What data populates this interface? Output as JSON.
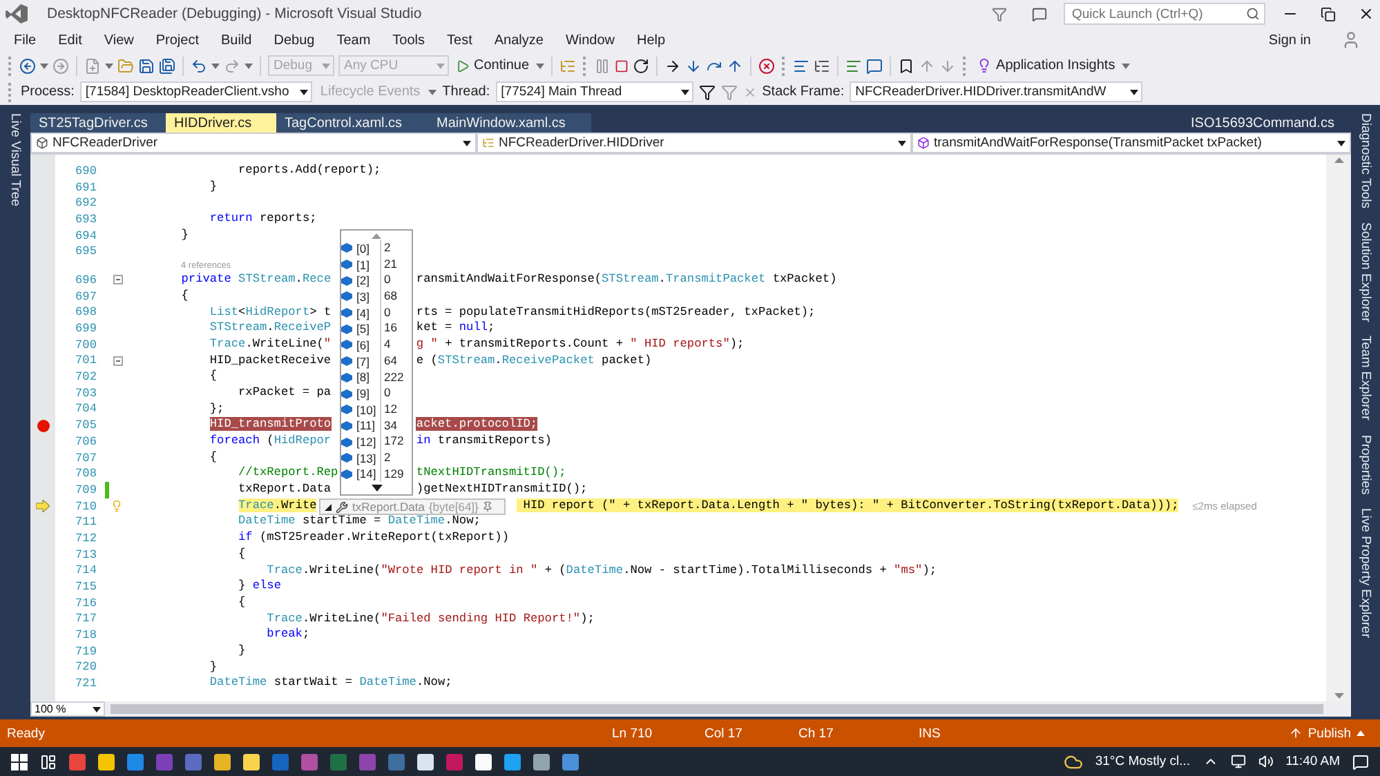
{
  "window": {
    "title": "DesktopNFCReader (Debugging) - Microsoft Visual Studio"
  },
  "quick_launch": {
    "placeholder": "Quick Launch (Ctrl+Q)"
  },
  "menu": [
    "File",
    "Edit",
    "View",
    "Project",
    "Build",
    "Debug",
    "Team",
    "Tools",
    "Test",
    "Analyze",
    "Window",
    "Help"
  ],
  "account": {
    "label": "Sign in"
  },
  "toolbar": {
    "configuration": {
      "value": "Debug",
      "disabled": true
    },
    "platform": {
      "value": "Any CPU",
      "disabled": true
    },
    "continue": "Continue",
    "insights": "Application Insights"
  },
  "debug_location": {
    "process_label": "Process:",
    "process": "[71584] DesktopReaderClient.vsho",
    "lifecycle": {
      "label": "Lifecycle Events",
      "disabled": true
    },
    "thread_label": "Thread:",
    "thread": "[77524] Main Thread",
    "stack_label": "Stack Frame:",
    "stack_frame": "NFCReaderDriver.HIDDriver.transmitAndW"
  },
  "left_panels": [
    "Live Visual Tree"
  ],
  "right_panels": [
    "Diagnostic Tools",
    "Solution Explorer",
    "Team Explorer",
    "Properties",
    "Live Property Explorer"
  ],
  "tabs": [
    {
      "label": "ST25TagDriver.cs",
      "selected": false
    },
    {
      "label": "HIDDriver.cs",
      "selected": true
    },
    {
      "label": "TagControl.xaml.cs",
      "selected": false
    },
    {
      "label": "MainWindow.xaml.cs",
      "selected": false
    }
  ],
  "preview_tab": {
    "label": "ISO15693Command.cs",
    "selected": false
  },
  "navigation": {
    "project": "NFCReaderDriver",
    "type": "NFCReaderDriver.HIDDriver",
    "member": "transmitAndWaitForResponse(TransmitPacket txPacket)"
  },
  "code": {
    "lines": [
      {
        "number": "690",
        "breakpoint": false,
        "current": false,
        "changed": false,
        "fold": false,
        "tokens": [
          {
            "kind": "plain",
            "text": "                reports.Add(report);"
          }
        ]
      },
      {
        "number": "691",
        "breakpoint": false,
        "current": false,
        "changed": false,
        "fold": false,
        "tokens": [
          {
            "kind": "plain",
            "text": "            }"
          }
        ]
      },
      {
        "number": "692",
        "breakpoint": false,
        "current": false,
        "changed": false,
        "fold": false
      },
      {
        "number": "693",
        "breakpoint": false,
        "current": false,
        "changed": false,
        "fold": false,
        "tokens": [
          {
            "kind": "keyword",
            "text": "            return"
          },
          {
            "kind": "plain",
            "text": " reports;"
          }
        ]
      },
      {
        "number": "694",
        "breakpoint": false,
        "current": false,
        "changed": false,
        "fold": false,
        "tokens": [
          {
            "kind": "plain",
            "text": "        }"
          }
        ]
      },
      {
        "number": "695",
        "breakpoint": false,
        "current": false,
        "changed": false,
        "fold": false
      },
      {
        "number": "696",
        "breakpoint": false,
        "current": false,
        "changed": false,
        "fold": true,
        "references": "4 references",
        "tokens": [
          {
            "kind": "keyword",
            "text": "        private "
          },
          {
            "kind": "type",
            "text": "STStream"
          },
          {
            "kind": "plain",
            "text": "."
          },
          {
            "kind": "type",
            "text": "Rece"
          }
        ],
        "after": [
          {
            "kind": "plain",
            "text": "ransmitAndWaitForResponse("
          },
          {
            "kind": "type",
            "text": "STStream"
          },
          {
            "kind": "plain",
            "text": "."
          },
          {
            "kind": "type",
            "text": "TransmitPacket"
          },
          {
            "kind": "plain",
            "text": " txPacket)"
          }
        ]
      },
      {
        "number": "697",
        "breakpoint": false,
        "current": false,
        "changed": false,
        "fold": false,
        "tokens": [
          {
            "kind": "plain",
            "text": "        {"
          }
        ]
      },
      {
        "number": "698",
        "breakpoint": false,
        "current": false,
        "changed": false,
        "fold": false,
        "tokens": [
          {
            "kind": "type",
            "text": "            List"
          },
          {
            "kind": "plain",
            "text": "<"
          },
          {
            "kind": "type",
            "text": "HidReport"
          },
          {
            "kind": "plain",
            "text": "> t"
          }
        ],
        "after": [
          {
            "kind": "plain",
            "text": "rts = populateTransmitHidReports(mST25reader, txPacket);"
          }
        ]
      },
      {
        "number": "699",
        "breakpoint": false,
        "current": false,
        "changed": false,
        "fold": false,
        "tokens": [
          {
            "kind": "type",
            "text": "            STStream"
          },
          {
            "kind": "plain",
            "text": "."
          },
          {
            "kind": "type",
            "text": "ReceiveP"
          }
        ],
        "after": [
          {
            "kind": "plain",
            "text": "ket = "
          },
          {
            "kind": "keyword",
            "text": "null"
          },
          {
            "kind": "plain",
            "text": ";"
          }
        ]
      },
      {
        "number": "700",
        "breakpoint": false,
        "current": false,
        "changed": false,
        "fold": false,
        "tokens": [
          {
            "kind": "type",
            "text": "            Trace"
          },
          {
            "kind": "plain",
            "text": ".WriteLine("
          },
          {
            "kind": "string",
            "text": "\""
          }
        ],
        "after": [
          {
            "kind": "string",
            "text": "g \""
          },
          {
            "kind": "plain",
            "text": " + transmitReports.Count + "
          },
          {
            "kind": "string",
            "text": "\" HID reports\""
          },
          {
            "kind": "plain",
            "text": ");"
          }
        ]
      },
      {
        "number": "701",
        "breakpoint": false,
        "current": false,
        "changed": false,
        "fold": true,
        "tokens": [
          {
            "kind": "plain",
            "text": "            HID_packetReceive"
          }
        ],
        "after": [
          {
            "kind": "plain",
            "text": "e ("
          },
          {
            "kind": "type",
            "text": "STStream"
          },
          {
            "kind": "plain",
            "text": "."
          },
          {
            "kind": "type",
            "text": "ReceivePacket"
          },
          {
            "kind": "plain",
            "text": " packet)"
          }
        ]
      },
      {
        "number": "702",
        "breakpoint": false,
        "current": false,
        "changed": false,
        "fold": false,
        "tokens": [
          {
            "kind": "plain",
            "text": "            {"
          }
        ]
      },
      {
        "number": "703",
        "breakpoint": false,
        "current": false,
        "changed": false,
        "fold": false,
        "tokens": [
          {
            "kind": "plain",
            "text": "                rxPacket = pa"
          }
        ]
      },
      {
        "number": "704",
        "breakpoint": false,
        "current": false,
        "changed": false,
        "fold": false,
        "tokens": [
          {
            "kind": "plain",
            "text": "            };"
          }
        ]
      },
      {
        "number": "705",
        "breakpoint": true,
        "current": false,
        "changed": false,
        "fold": false,
        "tokens": [
          {
            "kind": "plain",
            "text": "            HID_transmitProto"
          }
        ],
        "after": [
          {
            "kind": "plain",
            "text": "acket.protocolID;"
          }
        ]
      },
      {
        "number": "706",
        "breakpoint": false,
        "current": false,
        "changed": false,
        "fold": false,
        "tokens": [
          {
            "kind": "keyword",
            "text": "            foreach"
          },
          {
            "kind": "plain",
            "text": " ("
          },
          {
            "kind": "type",
            "text": "HidRepor"
          }
        ],
        "after": [
          {
            "kind": "keyword",
            "text": "in"
          },
          {
            "kind": "plain",
            "text": " transmitReports)"
          }
        ]
      },
      {
        "number": "707",
        "breakpoint": false,
        "current": false,
        "changed": false,
        "fold": false,
        "tokens": [
          {
            "kind": "plain",
            "text": "            {"
          }
        ]
      },
      {
        "number": "708",
        "breakpoint": false,
        "current": false,
        "changed": false,
        "fold": false,
        "tokens": [
          {
            "kind": "comment",
            "text": "                //txReport.Rep"
          }
        ],
        "after": [
          {
            "kind": "comment",
            "text": "tNextHIDTransmitID();"
          }
        ]
      },
      {
        "number": "709",
        "breakpoint": false,
        "current": false,
        "changed": true,
        "fold": false,
        "tokens": [
          {
            "kind": "plain",
            "text": "                txReport.Data"
          }
        ],
        "after": [
          {
            "kind": "plain",
            "text": ")getNextHIDTransmitID();"
          }
        ]
      },
      {
        "number": "710",
        "breakpoint": false,
        "current": true,
        "changed": false,
        "fold": false,
        "perf_tip": "≤2ms elapsed",
        "tokens": [
          {
            "kind": "type",
            "text": "                Trace"
          },
          {
            "kind": "plain",
            "text": ".Write"
          }
        ],
        "after": [
          {
            "kind": "plain",
            "text": " HID report (\" + txReport.Data.Length + \" bytes): \" + BitConverter.ToString(txReport.Data)));"
          }
        ]
      },
      {
        "number": "711",
        "breakpoint": false,
        "current": false,
        "changed": false,
        "fold": false,
        "tokens": [
          {
            "kind": "type",
            "text": "                DateTime"
          },
          {
            "kind": "plain",
            "text": " startTime = "
          },
          {
            "kind": "type",
            "text": "DateTime"
          },
          {
            "kind": "plain",
            "text": ".Now;"
          }
        ]
      },
      {
        "number": "712",
        "breakpoint": false,
        "current": false,
        "changed": false,
        "fold": false,
        "tokens": [
          {
            "kind": "keyword",
            "text": "                if"
          },
          {
            "kind": "plain",
            "text": " (mST25reader.WriteReport(txReport))"
          }
        ]
      },
      {
        "number": "713",
        "breakpoint": false,
        "current": false,
        "changed": false,
        "fold": false,
        "tokens": [
          {
            "kind": "plain",
            "text": "                {"
          }
        ]
      },
      {
        "number": "714",
        "breakpoint": false,
        "current": false,
        "changed": false,
        "fold": false,
        "tokens": [
          {
            "kind": "type",
            "text": "                    Trace"
          },
          {
            "kind": "plain",
            "text": ".WriteLine("
          },
          {
            "kind": "string",
            "text": "\"Wrote HID report in \""
          },
          {
            "kind": "plain",
            "text": " + ("
          },
          {
            "kind": "type",
            "text": "DateTime"
          },
          {
            "kind": "plain",
            "text": ".Now - startTime).TotalMilliseconds + "
          },
          {
            "kind": "string",
            "text": "\"ms\""
          },
          {
            "kind": "plain",
            "text": ");"
          }
        ]
      },
      {
        "number": "715",
        "breakpoint": false,
        "current": false,
        "changed": false,
        "fold": false,
        "tokens": [
          {
            "kind": "plain",
            "text": "                } "
          },
          {
            "kind": "keyword",
            "text": "else"
          }
        ]
      },
      {
        "number": "716",
        "breakpoint": false,
        "current": false,
        "changed": false,
        "fold": false,
        "tokens": [
          {
            "kind": "plain",
            "text": "                {"
          }
        ]
      },
      {
        "number": "717",
        "breakpoint": false,
        "current": false,
        "changed": false,
        "fold": false,
        "tokens": [
          {
            "kind": "type",
            "text": "                    Trace"
          },
          {
            "kind": "plain",
            "text": ".WriteLine("
          },
          {
            "kind": "string",
            "text": "\"Failed sending HID Report!\""
          },
          {
            "kind": "plain",
            "text": ");"
          }
        ]
      },
      {
        "number": "718",
        "breakpoint": false,
        "current": false,
        "changed": false,
        "fold": false,
        "tokens": [
          {
            "kind": "keyword",
            "text": "                    break"
          },
          {
            "kind": "plain",
            "text": ";"
          }
        ]
      },
      {
        "number": "719",
        "breakpoint": false,
        "current": false,
        "changed": false,
        "fold": false,
        "tokens": [
          {
            "kind": "plain",
            "text": "                }"
          }
        ]
      },
      {
        "number": "720",
        "breakpoint": false,
        "current": false,
        "changed": false,
        "fold": false,
        "tokens": [
          {
            "kind": "plain",
            "text": "            }"
          }
        ]
      },
      {
        "number": "721",
        "breakpoint": false,
        "current": false,
        "changed": false,
        "fold": false,
        "tokens": [
          {
            "kind": "type",
            "text": "            DateTime"
          },
          {
            "kind": "plain",
            "text": " startWait = "
          },
          {
            "kind": "type",
            "text": "DateTime"
          },
          {
            "kind": "plain",
            "text": ".Now;"
          }
        ]
      }
    ]
  },
  "value_list": {
    "items": [
      {
        "index": "[0]",
        "value": "2"
      },
      {
        "index": "[1]",
        "value": "21"
      },
      {
        "index": "[2]",
        "value": "0"
      },
      {
        "index": "[3]",
        "value": "68"
      },
      {
        "index": "[4]",
        "value": "0"
      },
      {
        "index": "[5]",
        "value": "16"
      },
      {
        "index": "[6]",
        "value": "4"
      },
      {
        "index": "[7]",
        "value": "64"
      },
      {
        "index": "[8]",
        "value": "222"
      },
      {
        "index": "[9]",
        "value": "0"
      },
      {
        "index": "[10]",
        "value": "12"
      },
      {
        "index": "[11]",
        "value": "34"
      },
      {
        "index": "[12]",
        "value": "172"
      },
      {
        "index": "[13]",
        "value": "2"
      },
      {
        "index": "[14]",
        "value": "129"
      }
    ]
  },
  "data_tip": {
    "expression": "txReport.Data",
    "type": "{byte[64]}"
  },
  "zoom": "100 %",
  "status_bar": {
    "state": "Ready",
    "line": "Ln 710",
    "column": "Col 17",
    "char": "Ch 17",
    "mode": "INS",
    "publish": "Publish"
  },
  "taskbar": {
    "weather": "31°C Mostly cl...",
    "time": "11:40 AM"
  }
}
